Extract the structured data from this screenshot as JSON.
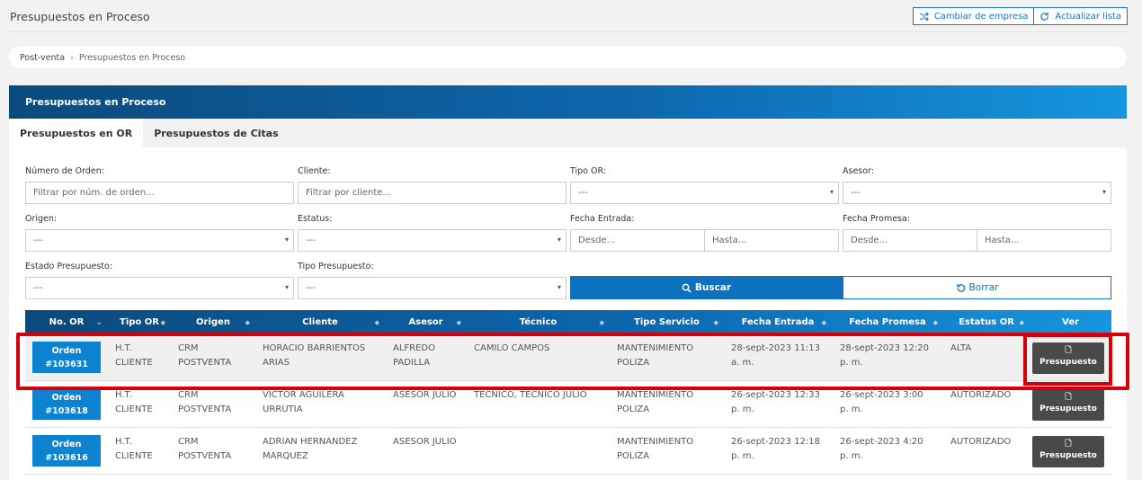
{
  "page": {
    "title": "Presupuestos en Proceso",
    "btn_change_company": "Cambiar de empresa",
    "btn_refresh": "Actualizar lista"
  },
  "breadcrumb": {
    "root": "Post-venta",
    "current": "Presupuestos en Proceso"
  },
  "panel": {
    "title": "Presupuestos en Proceso",
    "tabs": [
      {
        "label": "Presupuestos en OR",
        "active": true
      },
      {
        "label": "Presupuestos de Citas",
        "active": false
      }
    ]
  },
  "filters": {
    "numero_orden": {
      "label": "Número de Orden:",
      "placeholder": "Filtrar por núm. de orden..."
    },
    "cliente": {
      "label": "Cliente:",
      "placeholder": "Filtrar por cliente..."
    },
    "tipo_or": {
      "label": "Tipo OR:",
      "value": "---"
    },
    "asesor": {
      "label": "Asesor:",
      "value": "---"
    },
    "origen": {
      "label": "Origen:",
      "value": "---"
    },
    "estatus": {
      "label": "Estatus:",
      "value": "---"
    },
    "fecha_entrada": {
      "label": "Fecha Entrada:",
      "desde": "Desde...",
      "hasta": "Hasta..."
    },
    "fecha_promesa": {
      "label": "Fecha Promesa:",
      "desde": "Desde...",
      "hasta": "Hasta..."
    },
    "estado_presupuesto": {
      "label": "Estado Presupuesto:",
      "value": "---"
    },
    "tipo_presupuesto": {
      "label": "Tipo Presupuesto:",
      "value": "---"
    },
    "buscar": "Buscar",
    "borrar": "Borrar"
  },
  "table": {
    "headers": [
      "No. OR",
      "Tipo OR",
      "Origen",
      "Cliente",
      "Asesor",
      "Técnico",
      "Tipo Servicio",
      "Fecha Entrada",
      "Fecha Promesa",
      "Estatus OR",
      "Ver"
    ],
    "rows": [
      {
        "orden_label": "Orden",
        "orden": "#103631",
        "tipo_or": [
          "H.T.",
          "CLIENTE"
        ],
        "origen": [
          "CRM",
          "POSTVENTA"
        ],
        "cliente": [
          "HORACIO BARRIENTOS",
          "ARIAS"
        ],
        "asesor": [
          "ALFREDO",
          "PADILLA"
        ],
        "tecnico": "CAMILO CAMPOS",
        "tipo_servicio": [
          "MANTENIMIENTO",
          "POLIZA"
        ],
        "fecha_entrada": [
          "28-sept-2023 11:13",
          "a. m."
        ],
        "fecha_promesa": [
          "28-sept-2023 12:20",
          "p. m."
        ],
        "estatus": "ALTA",
        "ver": "Presupuesto"
      },
      {
        "orden_label": "Orden",
        "orden": "#103618",
        "tipo_or": [
          "H.T.",
          "CLIENTE"
        ],
        "origen": [
          "CRM",
          "POSTVENTA"
        ],
        "cliente": [
          "VICTOR AGUILERA",
          "URRUTIA"
        ],
        "asesor": [
          "ASESOR JULIO",
          ""
        ],
        "tecnico": "TECNICO, TECNICO JULIO",
        "tipo_servicio": [
          "MANTENIMIENTO",
          "POLIZA"
        ],
        "fecha_entrada": [
          "26-sept-2023 12:33",
          "p. m."
        ],
        "fecha_promesa": [
          "26-sept-2023 3:00",
          "p. m."
        ],
        "estatus": "AUTORIZADO",
        "ver": "Presupuesto"
      },
      {
        "orden_label": "Orden",
        "orden": "#103616",
        "tipo_or": [
          "H.T.",
          "CLIENTE"
        ],
        "origen": [
          "CRM",
          "POSTVENTA"
        ],
        "cliente": [
          "ADRIAN HERNANDEZ",
          "MARQUEZ"
        ],
        "asesor": [
          "ASESOR JULIO",
          ""
        ],
        "tecnico": "",
        "tipo_servicio": [
          "MANTENIMIENTO",
          "POLIZA"
        ],
        "fecha_entrada": [
          "26-sept-2023 12:18",
          "p. m."
        ],
        "fecha_promesa": [
          "26-sept-2023 4:20",
          "p. m."
        ],
        "estatus": "AUTORIZADO",
        "ver": "Presupuesto"
      }
    ]
  },
  "colors": {
    "accent": "#0d71c0",
    "highlight": "#d4000a",
    "dark_button": "#4a4a4a"
  }
}
